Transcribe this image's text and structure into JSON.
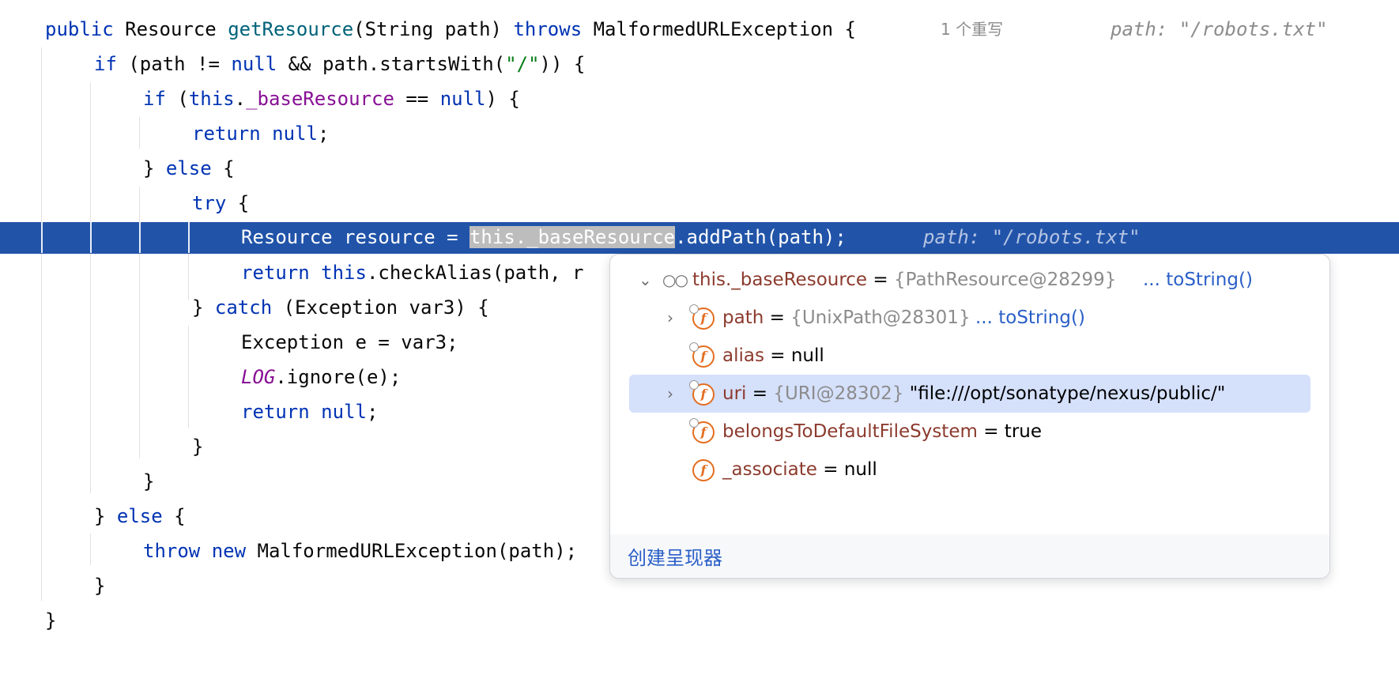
{
  "editor": {
    "line1": {
      "kw_public": "public",
      "type_resource": " Resource ",
      "fn_get": "getResource",
      "params": "(String path) ",
      "kw_throws": "throws",
      "exc": " MalformedURLException {",
      "overrides": "1 个重写",
      "hint": "path: \"/robots.txt\""
    },
    "line2": {
      "kw_if": "if",
      "p1": " (path != ",
      "kw_null": "null",
      "p2": " && path.startsWith(",
      "str": "\"/\"",
      "p3": ")) {"
    },
    "line3": {
      "kw_if": "if",
      "p1": " (",
      "kw_this": "this",
      "p2": ".",
      "fld": "_baseResource",
      "p3": " == ",
      "kw_null": "null",
      "p4": ") {"
    },
    "line4": {
      "kw_return": "return",
      "p1": " ",
      "kw_null": "null",
      "p2": ";"
    },
    "line5": {
      "p1": "} ",
      "kw_else": "else",
      "p2": " {"
    },
    "line6": {
      "kw_try": "try",
      "p1": " {"
    },
    "line7": {
      "p1": "Resource resource = ",
      "sel": "this._baseResource",
      "p2": ".addPath(path);",
      "hint": "path: \"/robots.txt\""
    },
    "line8": {
      "kw_return": "return",
      "p1": " ",
      "kw_this": "this",
      "p2": ".checkAlias(path, r"
    },
    "line9": {
      "p1": "} ",
      "kw_catch": "catch",
      "p2": " (Exception var3) {"
    },
    "line10": {
      "p1": "Exception e = var3;"
    },
    "line11": {
      "const": "LOG",
      "p1": ".ignore(e);"
    },
    "line12": {
      "kw_return": "return",
      "p1": " ",
      "kw_null": "null",
      "p2": ";"
    },
    "line13": {
      "p1": "}"
    },
    "line14": {
      "p1": "}"
    },
    "line15": {
      "p1": "} ",
      "kw_else": "else",
      "p2": " {"
    },
    "line16": {
      "kw_throw": "throw",
      "p1": " ",
      "kw_new": "new",
      "p2": " MalformedURLException(path);"
    },
    "line17": {
      "p1": "}"
    },
    "line18": {
      "p1": "}"
    }
  },
  "popup": {
    "root": {
      "name": "this._baseResource",
      "eq": " = ",
      "type": "{PathResource@28299}",
      "link": "... toString()"
    },
    "fields": [
      {
        "name": "path",
        "eq": " = ",
        "type": "{UnixPath@28301}",
        "link": "... toString()",
        "value": ""
      },
      {
        "name": "alias",
        "eq": " = ",
        "type": "",
        "link": "",
        "value": "null"
      },
      {
        "name": "uri",
        "eq": " = ",
        "type": "{URI@28302}",
        "link": "",
        "value": "\"file:///opt/sonatype/nexus/public/\""
      },
      {
        "name": "belongsToDefaultFileSystem",
        "eq": " = ",
        "type": "",
        "link": "",
        "value": "true"
      },
      {
        "name": "_associate",
        "eq": " = ",
        "type": "",
        "link": "",
        "value": "null"
      }
    ],
    "field_icon_letter": "f",
    "footer_link": "创建呈现器"
  },
  "colors": {
    "keyword": "#0033b3",
    "function": "#00627a",
    "field": "#871094",
    "string": "#067d17",
    "current_line": "#2154a9",
    "selection_row": "#d5e0fb",
    "field_icon": "#e36d1f",
    "link": "#2a5fc7"
  },
  "icons": {
    "expanded": "chevron-down-icon",
    "collapsed": "chevron-right-icon",
    "watch": "glasses-icon",
    "field": "field-icon"
  }
}
